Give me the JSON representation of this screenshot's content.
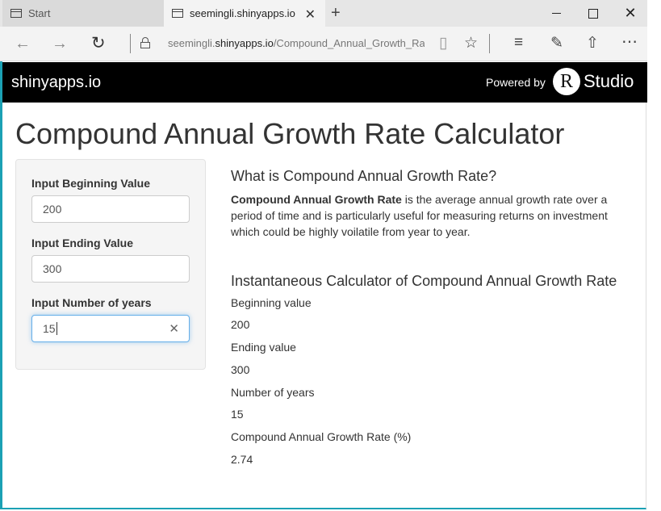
{
  "browser": {
    "tabs": [
      {
        "title": "Start",
        "active": false
      },
      {
        "title": "seemingli.shinyapps.io",
        "active": true
      }
    ],
    "url_host_prefix": "seemingli.",
    "url_host": "shinyapps.io",
    "url_path": "/Compound_Annual_Growth_Rat"
  },
  "shiny_header": {
    "brand": "shinyapps.io",
    "powered_by": "Powered by",
    "r_letter": "R",
    "studio": "Studio"
  },
  "page": {
    "title": "Compound Annual Growth Rate Calculator"
  },
  "sidebar": {
    "beginning_label": "Input Beginning Value",
    "beginning_value": "200",
    "ending_label": "Input Ending Value",
    "ending_value": "300",
    "years_label": "Input Number of years",
    "years_value": "15"
  },
  "main": {
    "what_heading": "What is Compound Annual Growth Rate?",
    "what_bold": "Compound Annual Growth Rate",
    "what_text": " is the average annual growth rate over a period of time and is particularly useful for measuring returns on investment which could be highly voilatile from year to year.",
    "calc_heading": "Instantaneous Calculator of Compound Annual Growth Rate",
    "outputs": [
      {
        "label": "Beginning value",
        "value": "200"
      },
      {
        "label": "Ending value",
        "value": "300"
      },
      {
        "label": "Number of years",
        "value": "15"
      },
      {
        "label": "Compound Annual Growth Rate (%)",
        "value": "2.74"
      }
    ]
  },
  "colors": {
    "accent": "#1ba1b4",
    "focus": "#66afe9",
    "header_bg": "#000000"
  }
}
